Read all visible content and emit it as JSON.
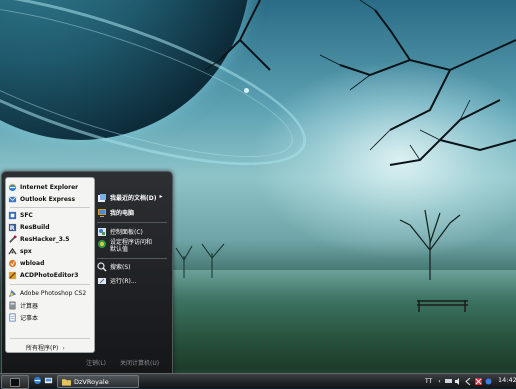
{
  "start_menu": {
    "pinned": [
      {
        "label": "Internet Explorer",
        "icon": "internet-explorer-icon"
      },
      {
        "label": "Outlook Express",
        "icon": "outlook-express-icon"
      }
    ],
    "recent": [
      {
        "label": "SFC",
        "icon": "sfc-icon"
      },
      {
        "label": "ResBuild",
        "icon": "resbuild-icon"
      },
      {
        "label": "ResHacker_3.5",
        "icon": "reshacker-icon"
      },
      {
        "label": "spx",
        "icon": "spx-icon"
      },
      {
        "label": "wbload",
        "icon": "wbload-icon"
      },
      {
        "label": "ACDPhotoEditor3",
        "icon": "acd-photo-editor-icon"
      },
      {
        "label": "Adobe Photoshop CS2",
        "icon": "photoshop-icon"
      },
      {
        "label": "计算器",
        "icon": "calculator-icon"
      },
      {
        "label": "记事本",
        "icon": "notepad-icon"
      }
    ],
    "all_programs": "所有程序(P)",
    "right": [
      {
        "label": "我最近的文档(D)",
        "icon": "recent-documents-icon"
      },
      {
        "label": "我的电脑",
        "icon": "my-computer-icon"
      },
      {
        "label": "控制面板(C)",
        "icon": "control-panel-icon"
      },
      {
        "label": "设定程序访问和默认值",
        "icon": "program-access-icon"
      },
      {
        "label": "搜索(S)",
        "icon": "search-icon"
      },
      {
        "label": "运行(R)...",
        "icon": "run-icon"
      }
    ],
    "log_off": "注销(L)",
    "shut_down": "关闭计算机(U)"
  },
  "taskbar": {
    "window_title": "DzVRoyale",
    "tray_label": "TT",
    "clock": "14:42"
  }
}
